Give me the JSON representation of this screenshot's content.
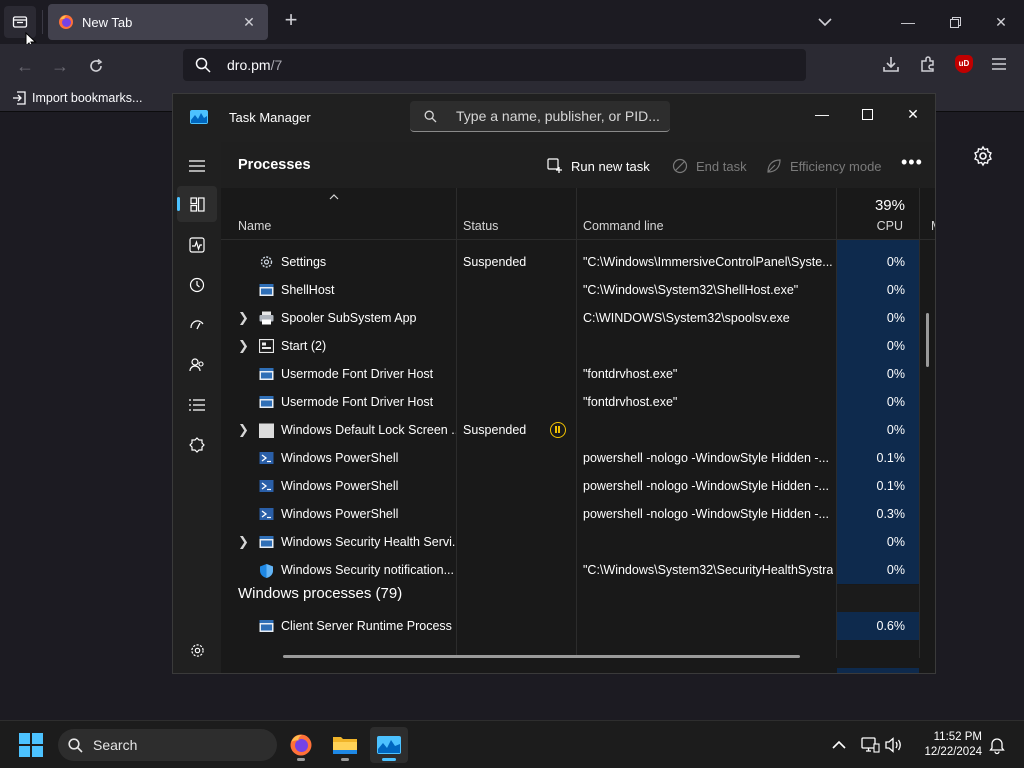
{
  "firefox": {
    "tab_title": "New Tab",
    "url_host": "dro.pm",
    "url_path": "/7",
    "bookmark_label": "Import bookmarks...",
    "ublock_label": "uD"
  },
  "task_manager": {
    "title": "Task Manager",
    "search_placeholder": "Type a name, publisher, or PID...",
    "page_title": "Processes",
    "toolbar": {
      "run_new_task": "Run new task",
      "end_task": "End task",
      "efficiency_mode": "Efficiency mode"
    },
    "columns": {
      "name": "Name",
      "status": "Status",
      "command_line": "Command line",
      "cpu_percent": "39%",
      "cpu": "CPU",
      "memory_cut": "M"
    },
    "rows": [
      {
        "name": "Settings",
        "status": "Suspended",
        "cmd": "\"C:\\Windows\\ImmersiveControlPanel\\Syste...",
        "cpu": "0%",
        "expandable": false,
        "icon": "gear-icon"
      },
      {
        "name": "ShellHost",
        "status": "",
        "cmd": "\"C:\\Windows\\System32\\ShellHost.exe\"",
        "cpu": "0%",
        "expandable": false,
        "icon": "window-icon"
      },
      {
        "name": "Spooler SubSystem App",
        "status": "",
        "cmd": "C:\\WINDOWS\\System32\\spoolsv.exe",
        "cpu": "0%",
        "expandable": true,
        "icon": "printer-icon"
      },
      {
        "name": "Start (2)",
        "status": "",
        "cmd": "",
        "cpu": "0%",
        "expandable": true,
        "icon": "start-app-icon"
      },
      {
        "name": "Usermode Font Driver Host",
        "status": "",
        "cmd": "\"fontdrvhost.exe\"",
        "cpu": "0%",
        "expandable": false,
        "icon": "window-icon"
      },
      {
        "name": "Usermode Font Driver Host",
        "status": "",
        "cmd": "\"fontdrvhost.exe\"",
        "cpu": "0%",
        "expandable": false,
        "icon": "window-icon"
      },
      {
        "name": "Windows Default Lock Screen ...",
        "status": "Suspended",
        "cmd": "",
        "cpu": "0%",
        "expandable": true,
        "icon": "blank-tile-icon"
      },
      {
        "name": "Windows PowerShell",
        "status": "",
        "cmd": "powershell  -nologo -WindowStyle Hidden -...",
        "cpu": "0.1%",
        "expandable": false,
        "icon": "powershell-icon"
      },
      {
        "name": "Windows PowerShell",
        "status": "",
        "cmd": "powershell  -nologo -WindowStyle Hidden -...",
        "cpu": "0.1%",
        "expandable": false,
        "icon": "powershell-icon"
      },
      {
        "name": "Windows PowerShell",
        "status": "",
        "cmd": "powershell  -nologo -WindowStyle Hidden -...",
        "cpu": "0.3%",
        "expandable": false,
        "icon": "powershell-icon"
      },
      {
        "name": "Windows Security Health Servi...",
        "status": "",
        "cmd": "",
        "cpu": "0%",
        "expandable": true,
        "icon": "window-icon"
      },
      {
        "name": "Windows Security notification...",
        "status": "",
        "cmd": "\"C:\\Windows\\System32\\SecurityHealthSystra...",
        "cpu": "0%",
        "expandable": false,
        "icon": "shield-icon"
      }
    ],
    "group_header": "Windows processes (79)",
    "group_rows": [
      {
        "name": "Client Server Runtime Process",
        "status": "",
        "cmd": "",
        "cpu": "0.6%",
        "icon": "window-icon"
      }
    ]
  },
  "taskbar": {
    "search_label": "Search",
    "time": "11:52 PM",
    "date": "12/22/2024"
  },
  "colors": {
    "accent": "#4cc2ff",
    "cpu_highlight": "#0e2a4d",
    "suspended_icon": "#f0c000"
  }
}
